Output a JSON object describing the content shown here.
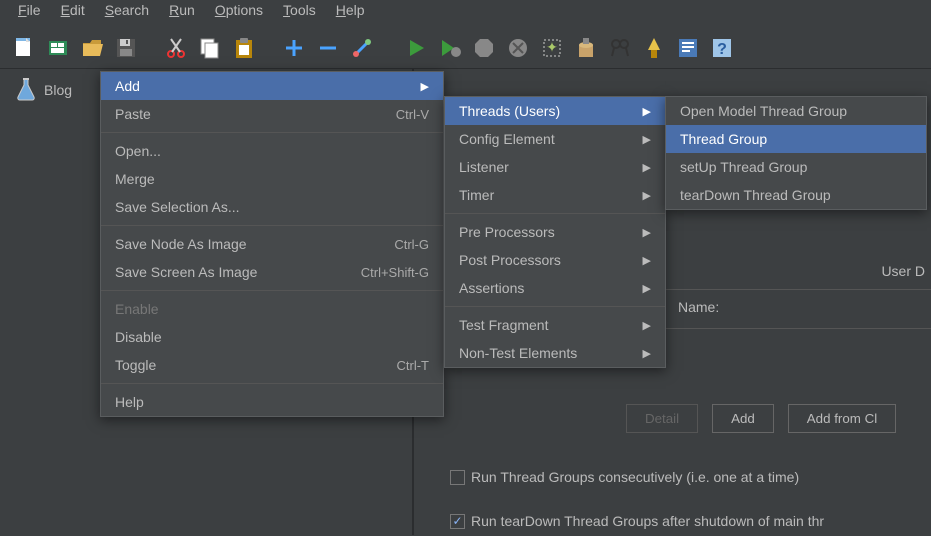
{
  "menubar": [
    "File",
    "Edit",
    "Search",
    "Run",
    "Options",
    "Tools",
    "Help"
  ],
  "tree": {
    "item0": "Blog"
  },
  "context": {
    "add": "Add",
    "paste": "Paste",
    "paste_accel": "Ctrl-V",
    "open": "Open...",
    "merge": "Merge",
    "save_sel": "Save Selection As...",
    "save_node": "Save Node As Image",
    "save_node_accel": "Ctrl-G",
    "save_screen": "Save Screen As Image",
    "save_screen_accel": "Ctrl+Shift-G",
    "enable": "Enable",
    "disable": "Disable",
    "toggle": "Toggle",
    "toggle_accel": "Ctrl-T",
    "help": "Help"
  },
  "sub_add": {
    "threads": "Threads (Users)",
    "config": "Config Element",
    "listener": "Listener",
    "timer": "Timer",
    "pre": "Pre Processors",
    "post": "Post Processors",
    "assert": "Assertions",
    "frag": "Test Fragment",
    "nontest": "Non-Test Elements"
  },
  "sub_threads": {
    "open_model": "Open Model Thread Group",
    "thread_group": "Thread Group",
    "setup": "setUp Thread Group",
    "teardown": "tearDown Thread Group"
  },
  "right": {
    "user_d": "User D",
    "name_label": "Name:",
    "btn_detail": "Detail",
    "btn_add": "Add",
    "btn_add_cl": "Add from Cl",
    "chk1": "Run Thread Groups consecutively (i.e. one at a time)",
    "chk2": "Run tearDown Thread Groups after shutdown of main thr"
  }
}
